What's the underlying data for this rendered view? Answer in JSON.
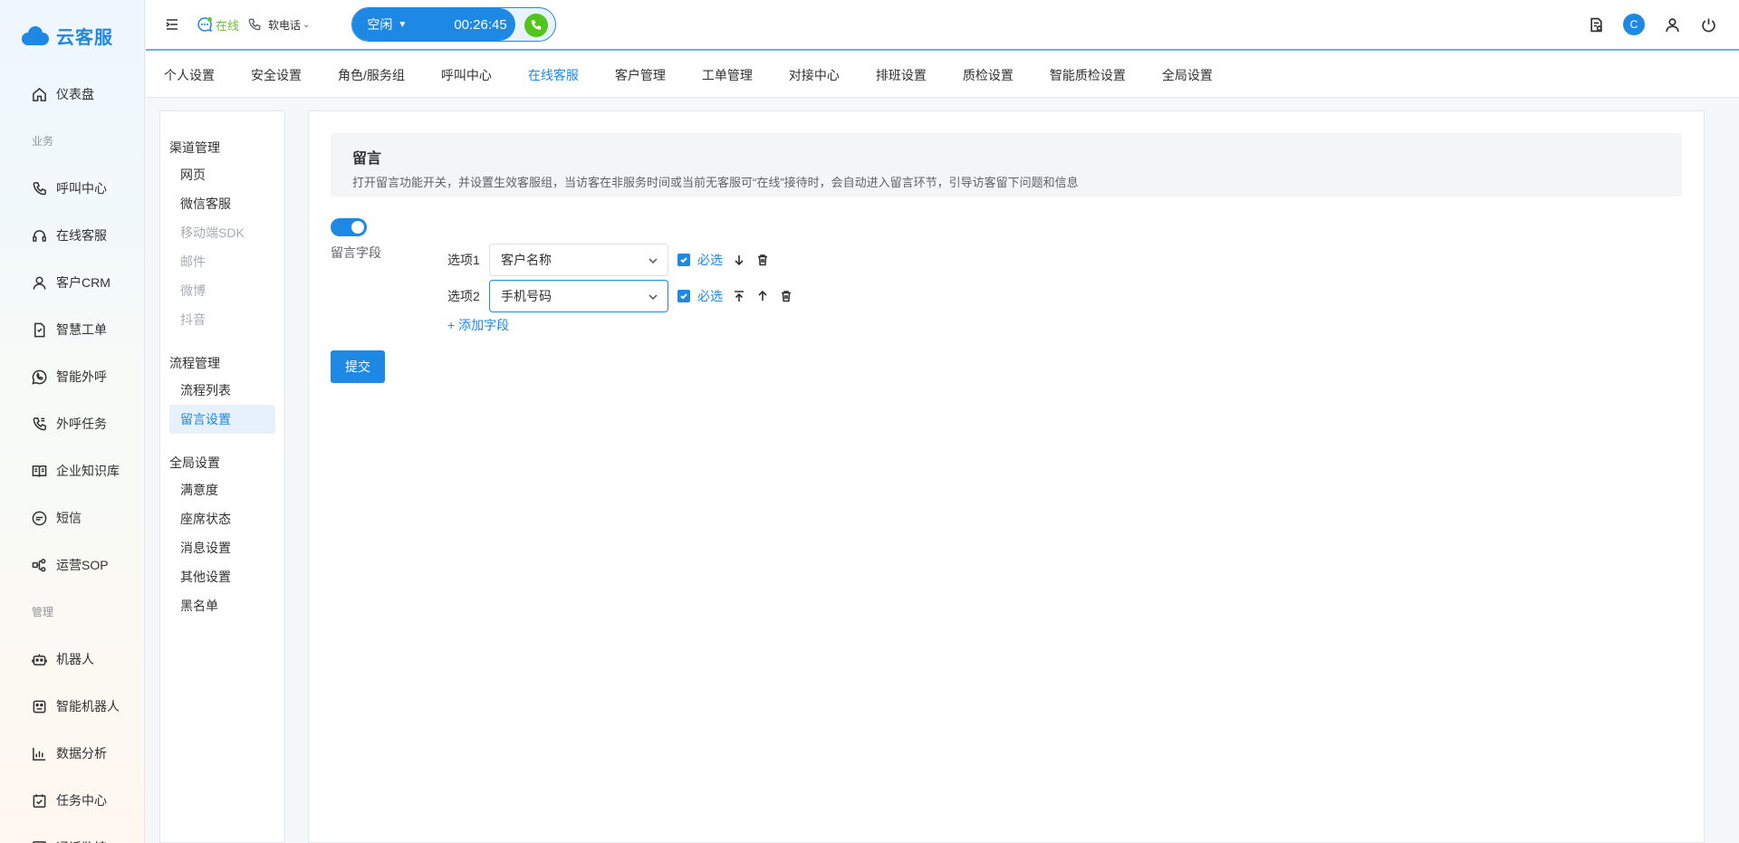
{
  "app": {
    "name": "云客服"
  },
  "sidebar": {
    "items": [
      {
        "type": "item",
        "label": "仪表盘",
        "icon": "home-icon"
      },
      {
        "type": "section",
        "label": "业务"
      },
      {
        "type": "item",
        "label": "呼叫中心",
        "icon": "phone-icon"
      },
      {
        "type": "item",
        "label": "在线客服",
        "icon": "headset-icon"
      },
      {
        "type": "item",
        "label": "客户CRM",
        "icon": "user-icon"
      },
      {
        "type": "item",
        "label": "智慧工单",
        "icon": "document-icon"
      },
      {
        "type": "item",
        "label": "智能外呼",
        "icon": "whatsapp-icon"
      },
      {
        "type": "item",
        "label": "外呼任务",
        "icon": "phone-task-icon"
      },
      {
        "type": "item",
        "label": "企业知识库",
        "icon": "book-icon"
      },
      {
        "type": "item",
        "label": "短信",
        "icon": "sms-icon"
      },
      {
        "type": "item",
        "label": "运营SOP",
        "icon": "flow-icon"
      },
      {
        "type": "section",
        "label": "管理"
      },
      {
        "type": "item",
        "label": "机器人",
        "icon": "robot-icon"
      },
      {
        "type": "item",
        "label": "智能机器人",
        "icon": "smart-robot-icon"
      },
      {
        "type": "item",
        "label": "数据分析",
        "icon": "chart-icon"
      },
      {
        "type": "item",
        "label": "任务中心",
        "icon": "task-icon"
      },
      {
        "type": "item",
        "label": "通话监控",
        "icon": "monitor-icon"
      }
    ]
  },
  "header": {
    "status": "在线",
    "phone_type": "软电话",
    "call_state": "空闲",
    "timer": "00:26:45",
    "avatar_letter": "C"
  },
  "tabs": [
    {
      "label": "个人设置",
      "active": false
    },
    {
      "label": "安全设置",
      "active": false
    },
    {
      "label": "角色/服务组",
      "active": false
    },
    {
      "label": "呼叫中心",
      "active": false
    },
    {
      "label": "在线客服",
      "active": true
    },
    {
      "label": "客户管理",
      "active": false
    },
    {
      "label": "工单管理",
      "active": false
    },
    {
      "label": "对接中心",
      "active": false
    },
    {
      "label": "排班设置",
      "active": false
    },
    {
      "label": "质检设置",
      "active": false
    },
    {
      "label": "智能质检设置",
      "active": false
    },
    {
      "label": "全局设置",
      "active": false
    }
  ],
  "subnav": {
    "groups": [
      {
        "title": "渠道管理",
        "items": [
          {
            "label": "网页",
            "state": "normal"
          },
          {
            "label": "微信客服",
            "state": "normal"
          },
          {
            "label": "移动端SDK",
            "state": "disabled"
          },
          {
            "label": "邮件",
            "state": "disabled"
          },
          {
            "label": "微博",
            "state": "disabled"
          },
          {
            "label": "抖音",
            "state": "disabled"
          }
        ]
      },
      {
        "title": "流程管理",
        "items": [
          {
            "label": "流程列表",
            "state": "normal"
          },
          {
            "label": "留言设置",
            "state": "active"
          }
        ]
      },
      {
        "title": "全局设置",
        "items": [
          {
            "label": "满意度",
            "state": "normal"
          },
          {
            "label": "座席状态",
            "state": "normal"
          },
          {
            "label": "消息设置",
            "state": "normal"
          },
          {
            "label": "其他设置",
            "state": "normal"
          },
          {
            "label": "黑名单",
            "state": "normal"
          }
        ]
      }
    ]
  },
  "main": {
    "notice_title": "留言",
    "notice_desc": "打开留言功能开关，并设置生效客服组，当访客在非服务时间或当前无客服可“在线”接待时，会自动进入留言环节，引导访客留下问题和信息",
    "toggle_on": true,
    "field_label": "留言字段",
    "options": [
      {
        "label": "选项1",
        "value": "客户名称",
        "required_label": "必选"
      },
      {
        "label": "选项2",
        "value": "手机号码",
        "required_label": "必选"
      }
    ],
    "add_field": "+ 添加字段",
    "submit": "提交"
  },
  "colors": {
    "primary": "#1e88e5",
    "online": "#67c23a",
    "call_button": "#52c41a"
  }
}
